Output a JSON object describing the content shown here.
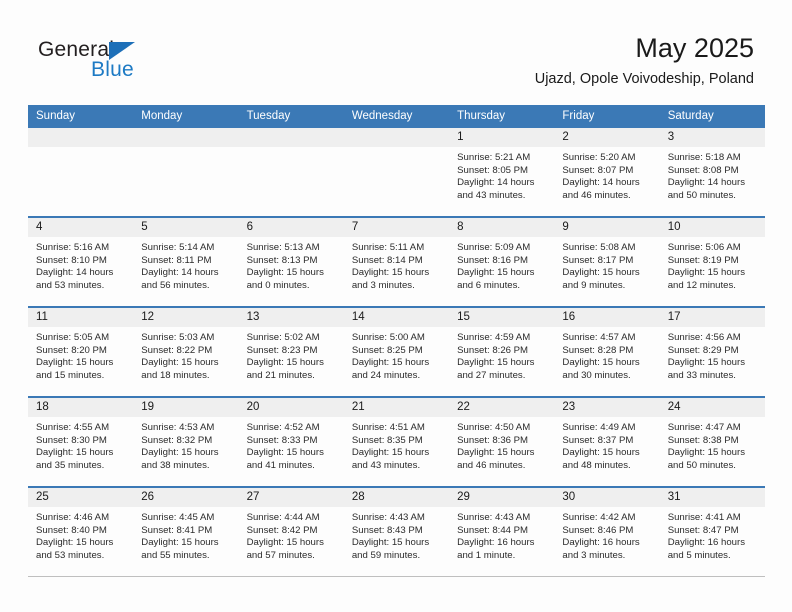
{
  "brand": {
    "word1": "General",
    "word2": "Blue",
    "triangle_color": "#1d6fb8",
    "blue_text_color": "#1d7ac4"
  },
  "header": {
    "title": "May 2025",
    "location": "Ujazd, Opole Voivodeship, Poland"
  },
  "theme": {
    "header_blue": "#3b79b6",
    "daynum_band": "#efefef",
    "row_separator": "#3b79b6",
    "bottom_border": "#bfbfbf"
  },
  "weekday_headers": [
    "Sunday",
    "Monday",
    "Tuesday",
    "Wednesday",
    "Thursday",
    "Friday",
    "Saturday"
  ],
  "weeks": [
    [
      {
        "day": "",
        "sunrise": "",
        "sunset": "",
        "daylight_line1": "",
        "daylight_line2": "",
        "empty": true
      },
      {
        "day": "",
        "sunrise": "",
        "sunset": "",
        "daylight_line1": "",
        "daylight_line2": "",
        "empty": true
      },
      {
        "day": "",
        "sunrise": "",
        "sunset": "",
        "daylight_line1": "",
        "daylight_line2": "",
        "empty": true
      },
      {
        "day": "",
        "sunrise": "",
        "sunset": "",
        "daylight_line1": "",
        "daylight_line2": "",
        "empty": true
      },
      {
        "day": "1",
        "sunrise": "Sunrise: 5:21 AM",
        "sunset": "Sunset: 8:05 PM",
        "daylight_line1": "Daylight: 14 hours",
        "daylight_line2": "and 43 minutes.",
        "empty": false
      },
      {
        "day": "2",
        "sunrise": "Sunrise: 5:20 AM",
        "sunset": "Sunset: 8:07 PM",
        "daylight_line1": "Daylight: 14 hours",
        "daylight_line2": "and 46 minutes.",
        "empty": false
      },
      {
        "day": "3",
        "sunrise": "Sunrise: 5:18 AM",
        "sunset": "Sunset: 8:08 PM",
        "daylight_line1": "Daylight: 14 hours",
        "daylight_line2": "and 50 minutes.",
        "empty": false
      }
    ],
    [
      {
        "day": "4",
        "sunrise": "Sunrise: 5:16 AM",
        "sunset": "Sunset: 8:10 PM",
        "daylight_line1": "Daylight: 14 hours",
        "daylight_line2": "and 53 minutes.",
        "empty": false
      },
      {
        "day": "5",
        "sunrise": "Sunrise: 5:14 AM",
        "sunset": "Sunset: 8:11 PM",
        "daylight_line1": "Daylight: 14 hours",
        "daylight_line2": "and 56 minutes.",
        "empty": false
      },
      {
        "day": "6",
        "sunrise": "Sunrise: 5:13 AM",
        "sunset": "Sunset: 8:13 PM",
        "daylight_line1": "Daylight: 15 hours",
        "daylight_line2": "and 0 minutes.",
        "empty": false
      },
      {
        "day": "7",
        "sunrise": "Sunrise: 5:11 AM",
        "sunset": "Sunset: 8:14 PM",
        "daylight_line1": "Daylight: 15 hours",
        "daylight_line2": "and 3 minutes.",
        "empty": false
      },
      {
        "day": "8",
        "sunrise": "Sunrise: 5:09 AM",
        "sunset": "Sunset: 8:16 PM",
        "daylight_line1": "Daylight: 15 hours",
        "daylight_line2": "and 6 minutes.",
        "empty": false
      },
      {
        "day": "9",
        "sunrise": "Sunrise: 5:08 AM",
        "sunset": "Sunset: 8:17 PM",
        "daylight_line1": "Daylight: 15 hours",
        "daylight_line2": "and 9 minutes.",
        "empty": false
      },
      {
        "day": "10",
        "sunrise": "Sunrise: 5:06 AM",
        "sunset": "Sunset: 8:19 PM",
        "daylight_line1": "Daylight: 15 hours",
        "daylight_line2": "and 12 minutes.",
        "empty": false
      }
    ],
    [
      {
        "day": "11",
        "sunrise": "Sunrise: 5:05 AM",
        "sunset": "Sunset: 8:20 PM",
        "daylight_line1": "Daylight: 15 hours",
        "daylight_line2": "and 15 minutes.",
        "empty": false
      },
      {
        "day": "12",
        "sunrise": "Sunrise: 5:03 AM",
        "sunset": "Sunset: 8:22 PM",
        "daylight_line1": "Daylight: 15 hours",
        "daylight_line2": "and 18 minutes.",
        "empty": false
      },
      {
        "day": "13",
        "sunrise": "Sunrise: 5:02 AM",
        "sunset": "Sunset: 8:23 PM",
        "daylight_line1": "Daylight: 15 hours",
        "daylight_line2": "and 21 minutes.",
        "empty": false
      },
      {
        "day": "14",
        "sunrise": "Sunrise: 5:00 AM",
        "sunset": "Sunset: 8:25 PM",
        "daylight_line1": "Daylight: 15 hours",
        "daylight_line2": "and 24 minutes.",
        "empty": false
      },
      {
        "day": "15",
        "sunrise": "Sunrise: 4:59 AM",
        "sunset": "Sunset: 8:26 PM",
        "daylight_line1": "Daylight: 15 hours",
        "daylight_line2": "and 27 minutes.",
        "empty": false
      },
      {
        "day": "16",
        "sunrise": "Sunrise: 4:57 AM",
        "sunset": "Sunset: 8:28 PM",
        "daylight_line1": "Daylight: 15 hours",
        "daylight_line2": "and 30 minutes.",
        "empty": false
      },
      {
        "day": "17",
        "sunrise": "Sunrise: 4:56 AM",
        "sunset": "Sunset: 8:29 PM",
        "daylight_line1": "Daylight: 15 hours",
        "daylight_line2": "and 33 minutes.",
        "empty": false
      }
    ],
    [
      {
        "day": "18",
        "sunrise": "Sunrise: 4:55 AM",
        "sunset": "Sunset: 8:30 PM",
        "daylight_line1": "Daylight: 15 hours",
        "daylight_line2": "and 35 minutes.",
        "empty": false
      },
      {
        "day": "19",
        "sunrise": "Sunrise: 4:53 AM",
        "sunset": "Sunset: 8:32 PM",
        "daylight_line1": "Daylight: 15 hours",
        "daylight_line2": "and 38 minutes.",
        "empty": false
      },
      {
        "day": "20",
        "sunrise": "Sunrise: 4:52 AM",
        "sunset": "Sunset: 8:33 PM",
        "daylight_line1": "Daylight: 15 hours",
        "daylight_line2": "and 41 minutes.",
        "empty": false
      },
      {
        "day": "21",
        "sunrise": "Sunrise: 4:51 AM",
        "sunset": "Sunset: 8:35 PM",
        "daylight_line1": "Daylight: 15 hours",
        "daylight_line2": "and 43 minutes.",
        "empty": false
      },
      {
        "day": "22",
        "sunrise": "Sunrise: 4:50 AM",
        "sunset": "Sunset: 8:36 PM",
        "daylight_line1": "Daylight: 15 hours",
        "daylight_line2": "and 46 minutes.",
        "empty": false
      },
      {
        "day": "23",
        "sunrise": "Sunrise: 4:49 AM",
        "sunset": "Sunset: 8:37 PM",
        "daylight_line1": "Daylight: 15 hours",
        "daylight_line2": "and 48 minutes.",
        "empty": false
      },
      {
        "day": "24",
        "sunrise": "Sunrise: 4:47 AM",
        "sunset": "Sunset: 8:38 PM",
        "daylight_line1": "Daylight: 15 hours",
        "daylight_line2": "and 50 minutes.",
        "empty": false
      }
    ],
    [
      {
        "day": "25",
        "sunrise": "Sunrise: 4:46 AM",
        "sunset": "Sunset: 8:40 PM",
        "daylight_line1": "Daylight: 15 hours",
        "daylight_line2": "and 53 minutes.",
        "empty": false
      },
      {
        "day": "26",
        "sunrise": "Sunrise: 4:45 AM",
        "sunset": "Sunset: 8:41 PM",
        "daylight_line1": "Daylight: 15 hours",
        "daylight_line2": "and 55 minutes.",
        "empty": false
      },
      {
        "day": "27",
        "sunrise": "Sunrise: 4:44 AM",
        "sunset": "Sunset: 8:42 PM",
        "daylight_line1": "Daylight: 15 hours",
        "daylight_line2": "and 57 minutes.",
        "empty": false
      },
      {
        "day": "28",
        "sunrise": "Sunrise: 4:43 AM",
        "sunset": "Sunset: 8:43 PM",
        "daylight_line1": "Daylight: 15 hours",
        "daylight_line2": "and 59 minutes.",
        "empty": false
      },
      {
        "day": "29",
        "sunrise": "Sunrise: 4:43 AM",
        "sunset": "Sunset: 8:44 PM",
        "daylight_line1": "Daylight: 16 hours",
        "daylight_line2": "and 1 minute.",
        "empty": false
      },
      {
        "day": "30",
        "sunrise": "Sunrise: 4:42 AM",
        "sunset": "Sunset: 8:46 PM",
        "daylight_line1": "Daylight: 16 hours",
        "daylight_line2": "and 3 minutes.",
        "empty": false
      },
      {
        "day": "31",
        "sunrise": "Sunrise: 4:41 AM",
        "sunset": "Sunset: 8:47 PM",
        "daylight_line1": "Daylight: 16 hours",
        "daylight_line2": "and 5 minutes.",
        "empty": false
      }
    ]
  ]
}
